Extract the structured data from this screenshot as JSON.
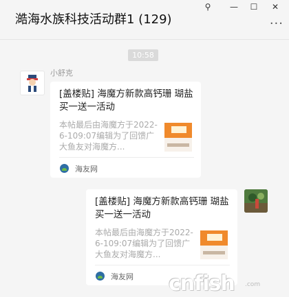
{
  "window": {
    "title": "澔海水族科技活动群1 (129)",
    "controls": {
      "pin": "⚲",
      "minimize": "—",
      "maximize": "☐",
      "close": "✕"
    },
    "more": "···"
  },
  "chat": {
    "time": "10:58",
    "messages": [
      {
        "sender": "小舒克",
        "avatar_icon": "cartoon-avatar-icon",
        "card": {
          "title": "[盖楼贴] 海魔方新款高钙珊 瑚盐买一送一活动",
          "desc": "本帖最后由海魔方于2022-6-109:07编辑为了回馈广大鱼友对海魔方...",
          "source": "海友网"
        }
      },
      {
        "sender": "",
        "avatar_icon": "photo-avatar-icon",
        "card": {
          "title": "[盖楼贴] 海魔方新款高钙珊 瑚盐买一送一活动",
          "desc": "本帖最后由海魔方于2022-6-109:07编辑为了回馈广大鱼友对海魔方...",
          "source": "海友网"
        }
      }
    ]
  },
  "watermark": {
    "main": "cnfish",
    "suffix": ".com"
  }
}
